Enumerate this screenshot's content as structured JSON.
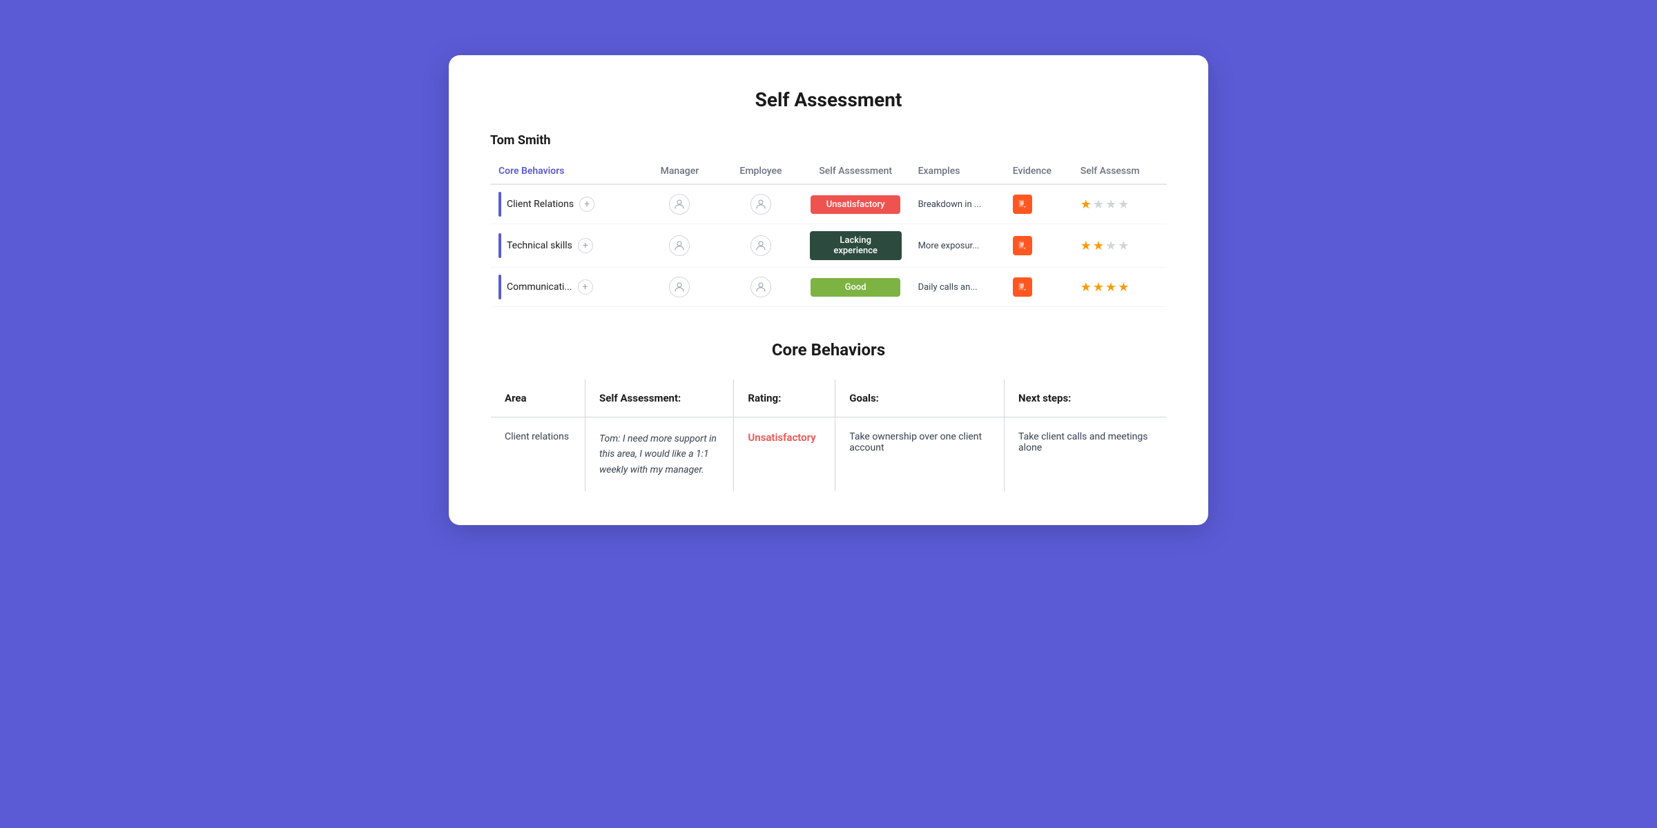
{
  "page": {
    "title": "Self Assessment",
    "employee_name": "Tom Smith",
    "background_color": "#5b5bd6"
  },
  "overview": {
    "columns": {
      "behavior": "Core Behaviors",
      "manager": "Manager",
      "employee": "Employee",
      "self_assessment": "Self Assessment",
      "examples": "Examples",
      "evidence": "Evidence",
      "self_assessment2": "Self Assessm"
    },
    "rows": [
      {
        "name": "Client Relations",
        "badge_text": "Unsatisfactory",
        "badge_class": "badge-unsatisfactory",
        "examples": "Breakdown in ...",
        "stars": [
          true,
          false,
          false,
          false
        ],
        "stars_count": 1
      },
      {
        "name": "Technical skills",
        "badge_text": "Lacking experience",
        "badge_class": "badge-lacking",
        "examples": "More exposur...",
        "stars": [
          true,
          true,
          false,
          false
        ],
        "stars_count": 2
      },
      {
        "name": "Communicati...",
        "badge_text": "Good",
        "badge_class": "badge-good",
        "examples": "Daily calls an...",
        "stars": [
          true,
          true,
          true,
          true
        ],
        "stars_count": 4
      }
    ]
  },
  "core_behaviors": {
    "section_title": "Core Behaviors",
    "columns": {
      "area": "Area",
      "self_assessment": "Self Assessment:",
      "rating": "Rating:",
      "goals": "Goals:",
      "next_steps": "Next steps:"
    },
    "rows": [
      {
        "area": "Client relations",
        "self_assessment_text": "Tom: I need more support in this area, I would like a 1:1 weekly with my manager.",
        "rating": "Unsatisfactory",
        "rating_class": "rating-unsatisfactory",
        "goals": "Take ownership over one client account",
        "next_steps": "Take client calls and meetings alone"
      }
    ]
  }
}
